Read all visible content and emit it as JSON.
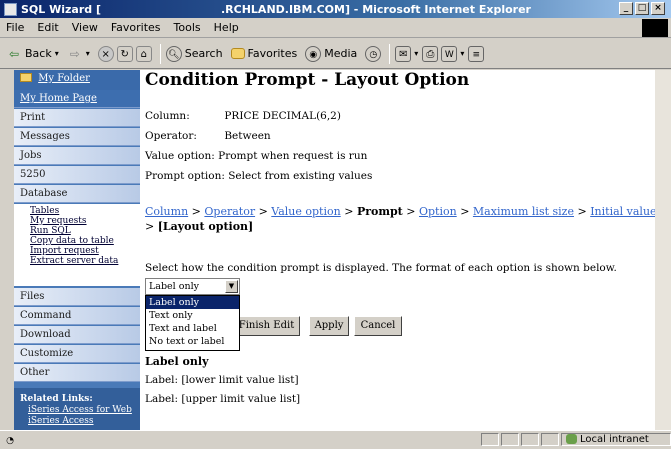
{
  "window": {
    "title_left": "SQL Wizard [",
    "title_right": ".RCHLAND.IBM.COM] - Microsoft Internet Explorer",
    "buttons": [
      "_",
      "□",
      "×"
    ]
  },
  "menu": [
    "File",
    "Edit",
    "View",
    "Favorites",
    "Tools",
    "Help"
  ],
  "toolbar": {
    "back": "Back",
    "search": "Search",
    "favorites": "Favorites",
    "media": "Media"
  },
  "nav": {
    "my_folder": "My Folder",
    "my_home_page": "My Home Page",
    "items_top": [
      "Print",
      "Messages",
      "Jobs",
      "5250",
      "Database"
    ],
    "database_sub": [
      "Tables",
      "My requests",
      "Run SQL",
      "Copy data to table",
      "Import request",
      "Extract server data"
    ],
    "items_bottom": [
      "Files",
      "Command",
      "Download",
      "Customize",
      "Other"
    ],
    "related_title": "Related Links:",
    "related_links": [
      "iSeries Access for Web",
      "iSeries Access"
    ]
  },
  "page": {
    "heading": "Condition Prompt - Layout Option",
    "column_label": "Column:",
    "column_value": "PRICE DECIMAL(6,2)",
    "operator_label": "Operator:",
    "operator_value": "Between",
    "value_option_label": "Value option:",
    "value_option_value": "Prompt when request is run",
    "prompt_option_label": "Prompt option:",
    "prompt_option_value": "Select from existing values",
    "breadcrumb": {
      "column": "Column",
      "operator": "Operator",
      "value_option": "Value option",
      "prompt": "Prompt",
      "option": "Option",
      "max_list_size": "Maximum list size",
      "initial_value": "Initial value",
      "layout_option": "[Layout option]",
      "sep": ">"
    },
    "instruction": "Select how the condition prompt is displayed. The format of each option is shown below.",
    "select_value": "Label only",
    "options": [
      "Label only",
      "Text only",
      "Text and label",
      "No text or label"
    ],
    "buttons": {
      "finish": "Finish Edit",
      "apply": "Apply",
      "cancel": "Cancel"
    },
    "preview_title": "Label only",
    "preview_lines": [
      "Label: [lower limit value list]",
      "Label: [upper limit value list]"
    ]
  },
  "status": {
    "zone": "Local intranet"
  }
}
